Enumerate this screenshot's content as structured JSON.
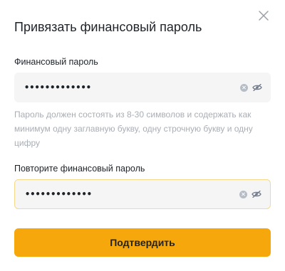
{
  "dialog": {
    "title": "Привязать финансовый пароль",
    "close_icon": "close-icon"
  },
  "password_field": {
    "label": "Финансовый пароль",
    "value": "•••••••••••••",
    "clear_icon": "clear-icon",
    "visibility_icon": "eye-off-icon"
  },
  "hint": "Пароль должен состоять из 8-30 символов и содержать как минимум одну заглавную букву, одну строчную букву и одну цифру",
  "confirm_field": {
    "label": "Повторите финансовый пароль",
    "value": "•••••••••••••",
    "clear_icon": "clear-icon",
    "visibility_icon": "eye-off-icon"
  },
  "submit": {
    "label": "Подтвердить",
    "color": "#f5a70b"
  },
  "colors": {
    "accent": "#f5a70b",
    "field_bg": "#f5f5f5",
    "hint_text": "#a9aeb5",
    "focus_border": "#f7d98a"
  }
}
